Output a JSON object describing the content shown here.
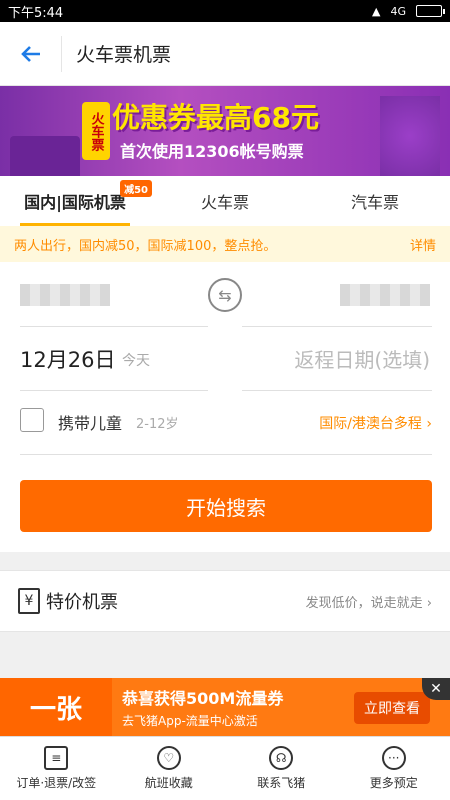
{
  "status": {
    "time": "下午5:44",
    "signal": "4G"
  },
  "header": {
    "title": "火车票机票"
  },
  "banner": {
    "line1": "优惠券最高68元",
    "line2": "首次使用12306帐号购票",
    "tag": "火车票"
  },
  "tabs": [
    {
      "label": "国内|国际机票",
      "badge": "减50"
    },
    {
      "label": "火车票"
    },
    {
      "label": "汽车票"
    }
  ],
  "notice": {
    "text": "两人出行，国内减50，国际减100，整点抢。",
    "more": "详情"
  },
  "form": {
    "date": "12月26日",
    "today": "今天",
    "return_placeholder": "返程日期(选填)",
    "child_label": "携带儿童",
    "child_age": "2-12岁",
    "intl_link": "国际/港澳台多程",
    "search_button": "开始搜索"
  },
  "special": {
    "label": "特价机票",
    "hint": "发现低价，说走就走"
  },
  "ad": {
    "big": "一张",
    "title": "恭喜获得500M流量券",
    "sub": "去飞猪App-流量中心激活",
    "button": "立即查看"
  },
  "bottom_nav": [
    {
      "label": "订单·退票/改签",
      "icon": "clipboard-icon"
    },
    {
      "label": "航班收藏",
      "icon": "heart-icon"
    },
    {
      "label": "联系飞猪",
      "icon": "headset-icon"
    },
    {
      "label": "更多预定",
      "icon": "more-icon"
    }
  ],
  "colors": {
    "accent": "#ff6a00",
    "tab_underline": "#ffb300",
    "notice_bg": "#fff8dc"
  }
}
